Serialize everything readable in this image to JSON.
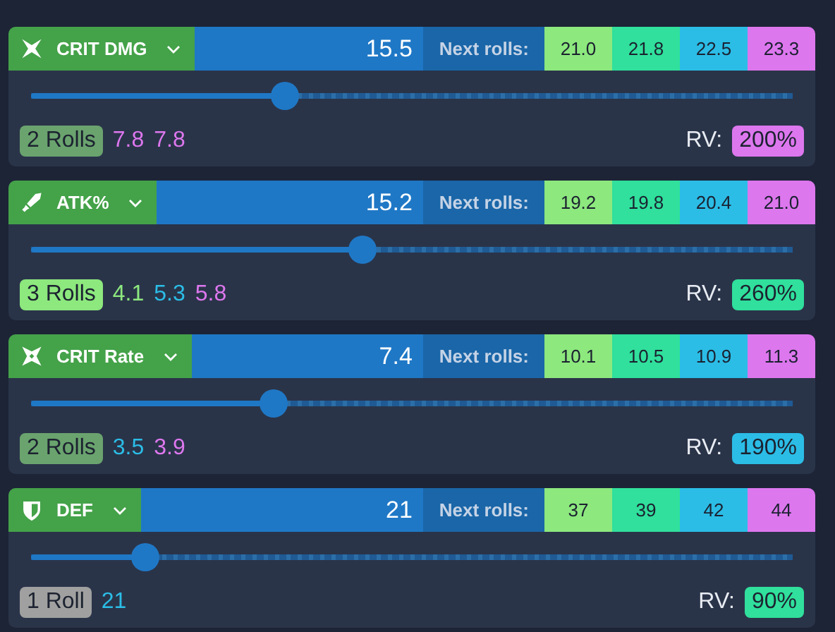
{
  "stats": [
    {
      "name": "CRIT DMG",
      "value": "15.5",
      "next_rolls_label": "Next rolls:",
      "rv_label": "RV:",
      "next_rolls": [
        {
          "value": "21.0",
          "color": "#8de87e"
        },
        {
          "value": "21.8",
          "color": "#30e09c"
        },
        {
          "value": "22.5",
          "color": "#2bbde6"
        },
        {
          "value": "23.3",
          "color": "#dd77ee"
        }
      ],
      "level": 0.333,
      "rolls": {
        "label": "2 Rolls",
        "color": "#6aa36e"
      },
      "roll_values": [
        {
          "value": "7.8",
          "color": "#dd77ee"
        },
        {
          "value": "7.8",
          "color": "#dd77ee"
        }
      ],
      "rv": {
        "value": "200%",
        "color": "#dd77ee"
      }
    },
    {
      "name": "ATK%",
      "value": "15.2",
      "next_rolls_label": "Next rolls:",
      "rv_label": "RV:",
      "next_rolls": [
        {
          "value": "19.2",
          "color": "#8de87e"
        },
        {
          "value": "19.8",
          "color": "#30e09c"
        },
        {
          "value": "20.4",
          "color": "#2bbde6"
        },
        {
          "value": "21.0",
          "color": "#dd77ee"
        }
      ],
      "level": 0.435,
      "rolls": {
        "label": "3 Rolls",
        "color": "#8de87e"
      },
      "roll_values": [
        {
          "value": "4.1",
          "color": "#8de87e"
        },
        {
          "value": "5.3",
          "color": "#2bbde6"
        },
        {
          "value": "5.8",
          "color": "#dd77ee"
        }
      ],
      "rv": {
        "value": "260%",
        "color": "#30e09c"
      }
    },
    {
      "name": "CRIT Rate",
      "value": "7.4",
      "next_rolls_label": "Next rolls:",
      "rv_label": "RV:",
      "next_rolls": [
        {
          "value": "10.1",
          "color": "#8de87e"
        },
        {
          "value": "10.5",
          "color": "#30e09c"
        },
        {
          "value": "10.9",
          "color": "#2bbde6"
        },
        {
          "value": "11.3",
          "color": "#dd77ee"
        }
      ],
      "level": 0.318,
      "rolls": {
        "label": "2 Rolls",
        "color": "#6aa36e"
      },
      "roll_values": [
        {
          "value": "3.5",
          "color": "#2bbde6"
        },
        {
          "value": "3.9",
          "color": "#dd77ee"
        }
      ],
      "rv": {
        "value": "190%",
        "color": "#2bbde6"
      }
    },
    {
      "name": "DEF",
      "value": "21",
      "next_rolls_label": "Next rolls:",
      "rv_label": "RV:",
      "next_rolls": [
        {
          "value": "37",
          "color": "#8de87e"
        },
        {
          "value": "39",
          "color": "#30e09c"
        },
        {
          "value": "42",
          "color": "#2bbde6"
        },
        {
          "value": "44",
          "color": "#dd77ee"
        }
      ],
      "level": 0.15,
      "rolls": {
        "label": "1 Roll",
        "color": "#a0a0a0"
      },
      "roll_values": [
        {
          "value": "21",
          "color": "#2bbde6"
        }
      ],
      "rv": {
        "value": "90%",
        "color": "#30e09c"
      }
    }
  ]
}
